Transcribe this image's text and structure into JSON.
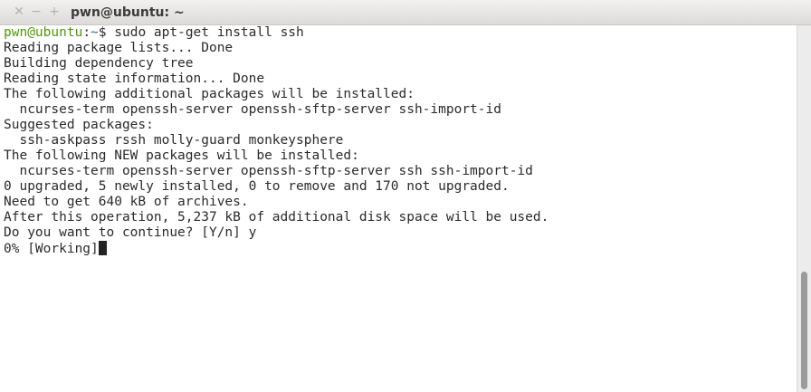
{
  "window": {
    "title": "pwn@ubuntu: ~",
    "close_glyph": "✕",
    "minimize_glyph": "−",
    "maximize_glyph": "+"
  },
  "terminal": {
    "prompt_user": "pwn@ubuntu",
    "prompt_sep": ":",
    "prompt_path": "~",
    "prompt_symbol": "$ ",
    "command": "sudo apt-get install ssh",
    "output_lines": [
      "Reading package lists... Done",
      "Building dependency tree",
      "Reading state information... Done",
      "The following additional packages will be installed:",
      "  ncurses-term openssh-server openssh-sftp-server ssh-import-id",
      "Suggested packages:",
      "  ssh-askpass rssh molly-guard monkeysphere",
      "The following NEW packages will be installed:",
      "  ncurses-term openssh-server openssh-sftp-server ssh ssh-import-id",
      "0 upgraded, 5 newly installed, 0 to remove and 170 not upgraded.",
      "Need to get 640 kB of archives.",
      "After this operation, 5,237 kB of additional disk space will be used.",
      "Do you want to continue? [Y/n] y"
    ],
    "progress_line": "0% [Working]"
  },
  "colors": {
    "prompt_user": "#4e9a06",
    "prompt_path": "#3465a4",
    "text": "#2b2b2b",
    "background": "#ffffff"
  }
}
